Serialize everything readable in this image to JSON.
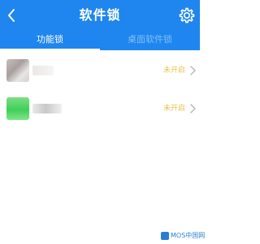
{
  "header": {
    "title": "软件锁",
    "back_icon": "chevron-left-icon",
    "settings_icon": "gear-icon",
    "background_color": "#1e86ee"
  },
  "tabs": [
    {
      "label": "功能锁",
      "active": true
    },
    {
      "label": "桌面软件锁",
      "active": false
    }
  ],
  "apps": [
    {
      "icon": "blurred-app-icon",
      "lock_label": "未开启"
    },
    {
      "icon": "blurred-app-icon",
      "lock_label": "未开启"
    }
  ],
  "colors": {
    "lock_label": "#e6c34f",
    "arrow": "#b5b5b5"
  },
  "watermark": {
    "text": "MOS中国网"
  }
}
